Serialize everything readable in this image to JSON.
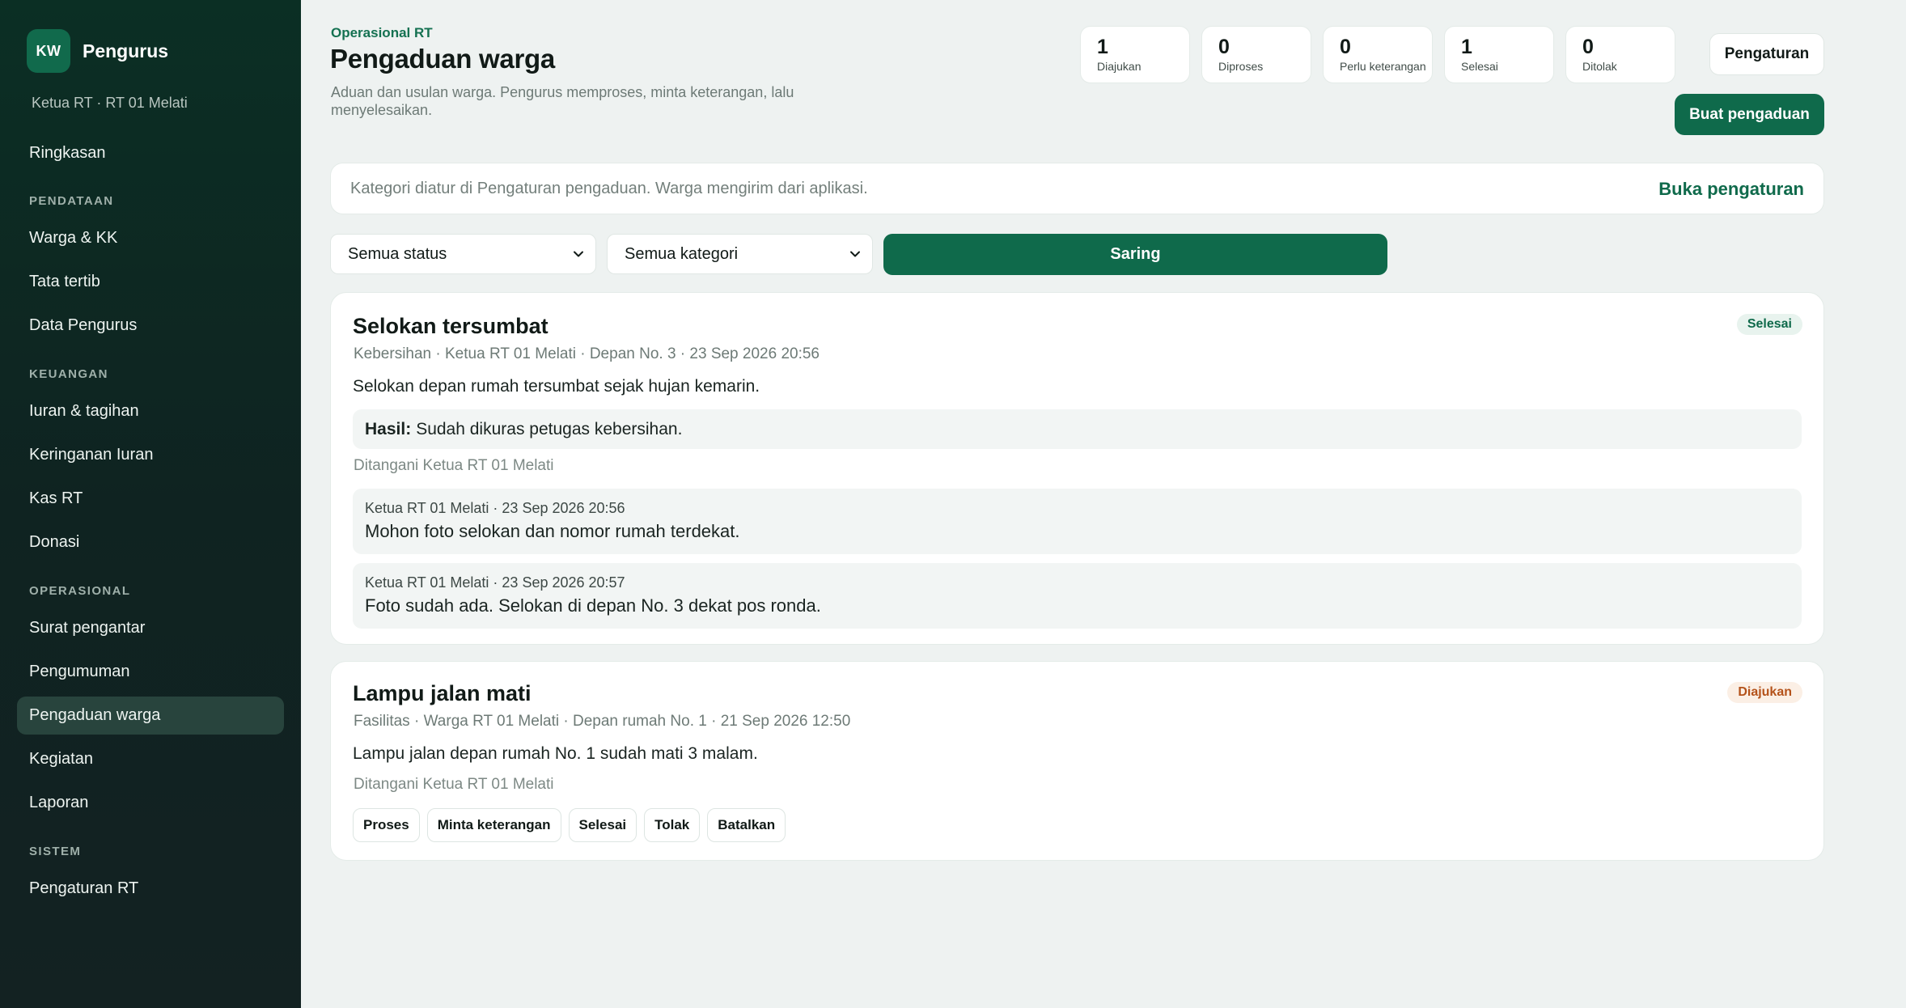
{
  "sidebar": {
    "avatar_initials": "KW",
    "brand": "Pengurus",
    "role": "Ketua RT · RT 01 Melati",
    "top_item": "Ringkasan",
    "sections": {
      "pendataan": "PENDATAAN",
      "keuangan": "KEUANGAN",
      "operasional": "OPERASIONAL",
      "sistem": "SISTEM"
    },
    "items": {
      "warga": "Warga & KK",
      "tata_tertib": "Tata tertib",
      "data_pengurus": "Data Pengurus",
      "iuran": "Iuran & tagihan",
      "keringanan": "Keringanan Iuran",
      "kas": "Kas RT",
      "donasi": "Donasi",
      "surat": "Surat pengantar",
      "pengumuman": "Pengumuman",
      "pengaduan": "Pengaduan warga",
      "kegiatan": "Kegiatan",
      "laporan": "Laporan",
      "pengaturan": "Pengaturan RT"
    },
    "active_item": "Pengaduan warga"
  },
  "header": {
    "eyebrow": "Operasional RT",
    "title": "Pengaduan warga",
    "description": "Aduan dan usulan warga. Pengurus memproses, minta keterangan, lalu menyelesaikan."
  },
  "stats": [
    {
      "value": "1",
      "label": "Diajukan"
    },
    {
      "value": "0",
      "label": "Diproses"
    },
    {
      "value": "0",
      "label": "Perlu keterangan"
    },
    {
      "value": "1",
      "label": "Selesai"
    },
    {
      "value": "0",
      "label": "Ditolak"
    }
  ],
  "buttons": {
    "settings": "Pengaturan",
    "create": "Buat pengaduan",
    "filter": "Saring"
  },
  "info_bar": {
    "message": "Kategori diatur di Pengaturan pengaduan. Warga mengirim dari aplikasi.",
    "link": "Buka pengaturan"
  },
  "filters": {
    "status": "Semua status",
    "category": "Semua kategori"
  },
  "complaints": [
    {
      "title": "Selokan tersumbat",
      "status": "Selesai",
      "meta": "Kebersihan · Ketua RT 01 Melati · Depan No. 3 · 23 Sep 2026 20:56",
      "body": "Selokan depan rumah tersumbat sejak hujan kemarin.",
      "result_label": "Hasil:",
      "result_text": "Sudah dikuras petugas kebersihan.",
      "handled_by": "Ditangani Ketua RT 01 Melati",
      "notes": [
        {
          "meta": "Ketua RT 01 Melati · 23 Sep 2026 20:56",
          "text": "Mohon foto selokan dan nomor rumah terdekat."
        },
        {
          "meta": "Ketua RT 01 Melati · 23 Sep 2026 20:57",
          "text": "Foto sudah ada. Selokan di depan No. 3 dekat pos ronda."
        }
      ]
    },
    {
      "title": "Lampu jalan mati",
      "status": "Diajukan",
      "meta": "Fasilitas · Warga RT 01 Melati · Depan rumah No. 1 · 21 Sep 2026 12:50",
      "body": "Lampu jalan depan rumah No. 1 sudah mati 3 malam.",
      "handled_by": "Ditangani Ketua RT 01 Melati",
      "actions": [
        "Proses",
        "Minta keterangan",
        "Selesai",
        "Tolak",
        "Batalkan"
      ]
    }
  ],
  "colors": {
    "brand_green": "#0f6a4b",
    "sidebar_bg": "#0f2321",
    "done_badge": "#0f6a4b",
    "submitted_badge": "#b4521a"
  },
  "icons": {
    "select_chevron": "chevron-down-icon"
  }
}
